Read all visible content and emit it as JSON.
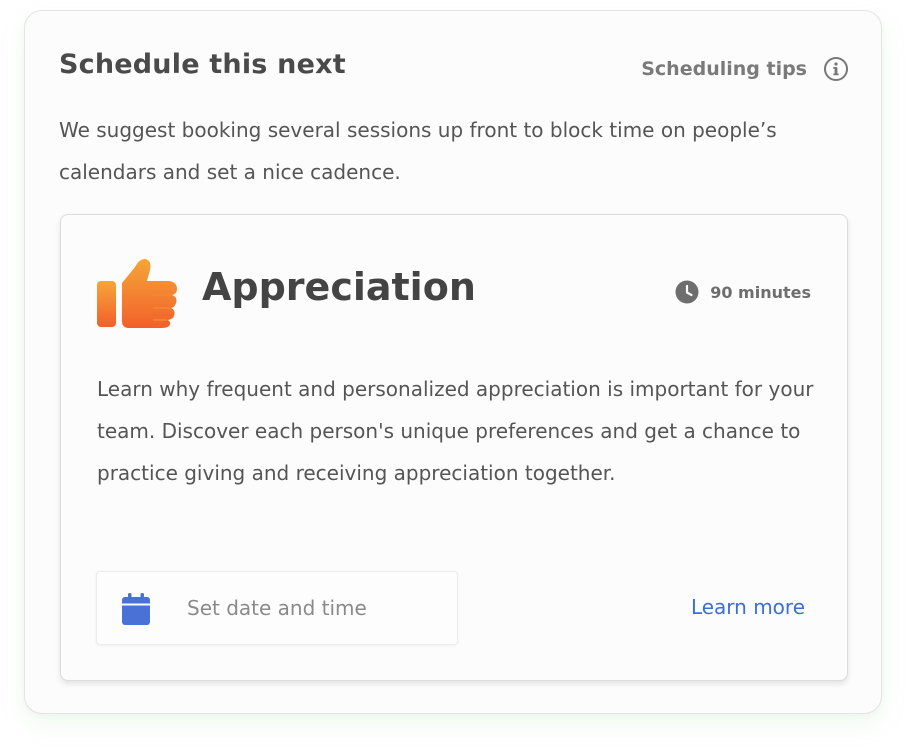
{
  "schedule": {
    "title": "Schedule this next",
    "tips_label": "Scheduling tips",
    "tips_icon": "info-icon",
    "intro": "We suggest booking several sessions up front to block time on people’s calendars and set a nice cadence."
  },
  "session": {
    "icon": "thumbs-up-icon",
    "title": "Appreciation",
    "duration_icon": "clock-icon",
    "duration": "90 minutes",
    "description": "Learn why frequent and personalized appreciation is important for your team. Discover each person's unique preferences and get a chance to practice giving and receiving appreciation together.",
    "date_picker": {
      "icon": "calendar-icon",
      "placeholder": "Set date and time"
    },
    "learn_more": "Learn more"
  },
  "colors": {
    "accent_link": "#3b6fd8",
    "calendar_icon": "#4a72d6",
    "thumb_gradient_top": "#f5a63a",
    "thumb_gradient_bottom": "#f2602a",
    "title_text": "#444444"
  }
}
